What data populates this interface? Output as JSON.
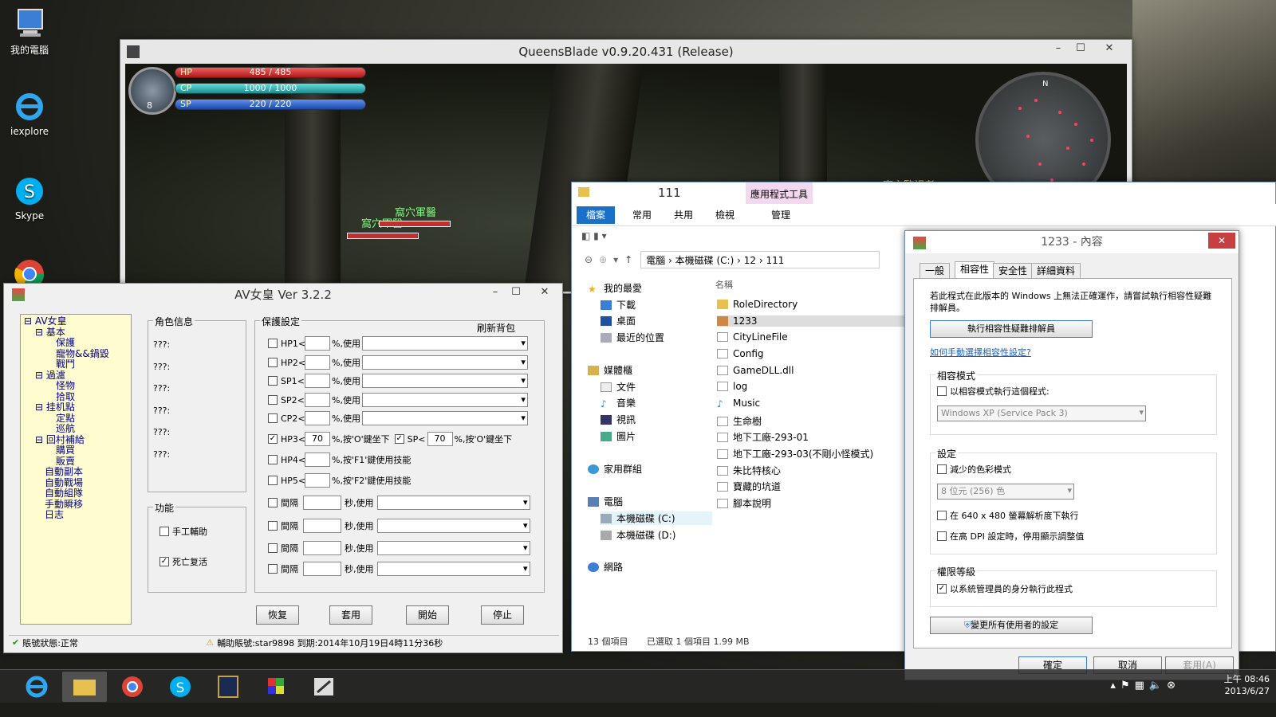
{
  "desktop": {
    "icons": [
      {
        "label": "我的電腦"
      },
      {
        "label": "iexplore"
      },
      {
        "label": "Skype"
      }
    ]
  },
  "game": {
    "title": "QueensBlade v0.9.20.431 (Release)",
    "level": "8",
    "hp_label": "HP",
    "hp": "485 / 485",
    "cp_label": "CP",
    "cp": "1000 / 1000",
    "sp_label": "SP",
    "sp": "220 / 220",
    "npc1": "窩穴軍醫",
    "npc2": "窩穴軍醫",
    "npc3": "窩穴監視者",
    "compass": "N"
  },
  "av": {
    "title": "AV女皇   Ver  3.2.2",
    "tree": [
      "AV女皇",
      "基本",
      "保護",
      "寵物&&鍋毀",
      "戰鬥",
      "過濾",
      "怪物",
      "拾取",
      "挂机點",
      "定點",
      "巡航",
      "回村補給",
      "購買",
      "販賣",
      "自動副本",
      "自動戰場",
      "自動組隊",
      "手動瞬移",
      "日志"
    ],
    "char_info_title": "角色信息",
    "char_rows": [
      "???:",
      "???:",
      "???:",
      "???:",
      "???:",
      "???:"
    ],
    "func_title": "功能",
    "manual": "手工輔助",
    "revive": "死亡复活",
    "protect_title": "保護設定",
    "refresh": "刷新背包",
    "hp1": "HP1<",
    "hp2": "HP2<",
    "sp1": "SP1<",
    "sp2": "SP2<",
    "cp2": "CP2<",
    "use": "%,使用",
    "hp3": "HP3<",
    "hp3_val": "70",
    "sp_lt": "SP<",
    "sp_val": "70",
    "sit": "%,按'O'鍵坐下",
    "hp4": "HP4<",
    "hp4_text": "%,按'F1'鍵使用技能",
    "hp5": "HP5<",
    "hp5_text": "%,按'F2'鍵使用技能",
    "interval": "間隔",
    "sec_use": "秒,使用",
    "btn_restore": "恢复",
    "btn_apply": "套用",
    "btn_start": "開始",
    "btn_stop": "停止",
    "status_acct": "賬號狀態:正常",
    "status_info": "輔助賬號:star9898 到期:2014年10月19日4時11分36秒"
  },
  "explorer": {
    "title": "111",
    "app_tools": "應用程式工具",
    "tabs": [
      "檔案",
      "常用",
      "共用",
      "檢視",
      "管理"
    ],
    "path": [
      "電腦",
      "本機磁碟 (C:)",
      "12",
      "111"
    ],
    "col_name": "名稱",
    "nav": [
      {
        "t": "我的最愛",
        "ind": 0
      },
      {
        "t": "下載",
        "ind": 1
      },
      {
        "t": "桌面",
        "ind": 1
      },
      {
        "t": "最近的位置",
        "ind": 1
      },
      {
        "t": "媒體櫃",
        "ind": 0
      },
      {
        "t": "文件",
        "ind": 1
      },
      {
        "t": "音樂",
        "ind": 1
      },
      {
        "t": "視訊",
        "ind": 1
      },
      {
        "t": "圖片",
        "ind": 1
      },
      {
        "t": "家用群組",
        "ind": 0
      },
      {
        "t": "電腦",
        "ind": 0
      },
      {
        "t": "本機磁碟 (C:)",
        "ind": 1
      },
      {
        "t": "本機磁碟 (D:)",
        "ind": 1
      },
      {
        "t": "網路",
        "ind": 0
      }
    ],
    "files": [
      "RoleDirectory",
      "1233",
      "CityLineFile",
      "Config",
      "GameDLL.dll",
      "log",
      "Music",
      "生命樹",
      "地下工廠-293-01",
      "地下工廠-293-03(不剛小怪模式)",
      "朱比特核心",
      "寶藏的坑道",
      "腳本說明"
    ],
    "count": "13 個項目",
    "selected": "已選取 1 個項目  1.99 MB"
  },
  "props": {
    "title": "1233 - 內容",
    "tabs": [
      "一般",
      "相容性",
      "安全性",
      "詳細資料"
    ],
    "desc": "若此程式在此版本的 Windows 上無法正確運作，請嘗試執行相容性疑難排解員。",
    "troubleshoot": "執行相容性疑難排解員",
    "link": "如何手動選擇相容性設定?",
    "compat_title": "相容模式",
    "compat_cb": "以相容模式執行這個程式:",
    "compat_sel": "Windows XP (Service Pack 3)",
    "settings_title": "設定",
    "reduced": "減少的色彩模式",
    "color_sel": "8 位元 (256) 色",
    "res640": "在 640 x 480 螢幕解析度下執行",
    "dpi": "在高 DPI 設定時，停用顯示調整值",
    "priv_title": "權限等級",
    "admin": "以系統管理員的身分執行此程式",
    "change_all": "變更所有使用者的設定",
    "ok": "確定",
    "cancel": "取消",
    "apply": "套用(A)"
  },
  "tray": {
    "time": "上午 08:46",
    "date": "2013/6/27"
  },
  "colors": {
    "accent": "#1a70c8",
    "hp": "#d83030",
    "cp": "#2fb0b0",
    "sp": "#2060c0"
  }
}
